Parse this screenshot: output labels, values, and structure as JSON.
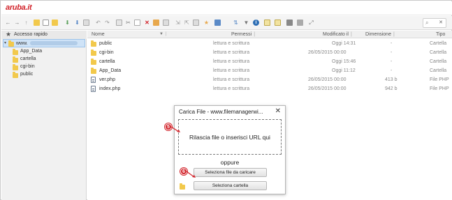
{
  "brand": {
    "logo_text": "aruba.it",
    "color": "#d2232a"
  },
  "toolbar": {
    "icons": [
      "back-arrow-icon",
      "forward-arrow-icon",
      "up-arrow-icon",
      "new-folder-icon",
      "new-file-icon",
      "upload-icon",
      "download-icon",
      "clipboard-icon",
      "undo-icon",
      "redo-icon",
      "copy-icon",
      "cut-icon",
      "paste-icon",
      "delete-icon",
      "rename-icon",
      "duplicate-icon",
      "extract-icon",
      "archive-icon",
      "search-file-icon",
      "favorite-icon",
      "select-all-icon",
      "sort-icon",
      "filter-icon",
      "info-icon",
      "view-icon",
      "view-list-icon",
      "view-icons-icon",
      "view-details-icon",
      "fullscreen-icon"
    ],
    "search_placeholder": ""
  },
  "sidebar": {
    "header": "Accesso rapido",
    "root_label": "www.",
    "items": [
      {
        "label": "App_Data"
      },
      {
        "label": "cartella"
      },
      {
        "label": "cgi-bin"
      },
      {
        "label": "public"
      }
    ]
  },
  "list": {
    "columns": {
      "name": "Nome",
      "perms": "Permessi",
      "modified": "Modificato il",
      "size": "Dimensione",
      "type": "Tipo"
    },
    "rows": [
      {
        "name": "public",
        "icon": "folder-icon",
        "perms": "lettura e scrittura",
        "modified": "Oggi 14:31",
        "size": "-",
        "type": "Cartella"
      },
      {
        "name": "cgi-bin",
        "icon": "folder-icon",
        "perms": "lettura e scrittura",
        "modified": "26/05/2015 00:00",
        "size": "-",
        "type": "Cartella"
      },
      {
        "name": "cartella",
        "icon": "folder-icon",
        "perms": "lettura e scrittura",
        "modified": "Oggi 15:46",
        "size": "-",
        "type": "Cartella"
      },
      {
        "name": "App_Data",
        "icon": "folder-icon",
        "perms": "lettura e scrittura",
        "modified": "Oggi 11:12",
        "size": "-",
        "type": "Cartella"
      },
      {
        "name": "ver.php",
        "icon": "php-file-icon",
        "perms": "lettura e scrittura",
        "modified": "26/05/2015 00:00",
        "size": "413 b",
        "type": "File PHP"
      },
      {
        "name": "index.php",
        "icon": "php-file-icon",
        "perms": "lettura e scrittura",
        "modified": "26/05/2015 00:00",
        "size": "942 b",
        "type": "File PHP"
      }
    ]
  },
  "dialog": {
    "title": "Carica File - www.filemanagerwi...",
    "close": "✕",
    "dropzone_text": "Rilascia file o inserisci URL qui",
    "or_text": "oppure",
    "select_files_button": "Seleziona file da caricare",
    "select_folder_button": "Seleziona cartella"
  },
  "annotations": {
    "step_a": "5",
    "step_b": "6"
  }
}
